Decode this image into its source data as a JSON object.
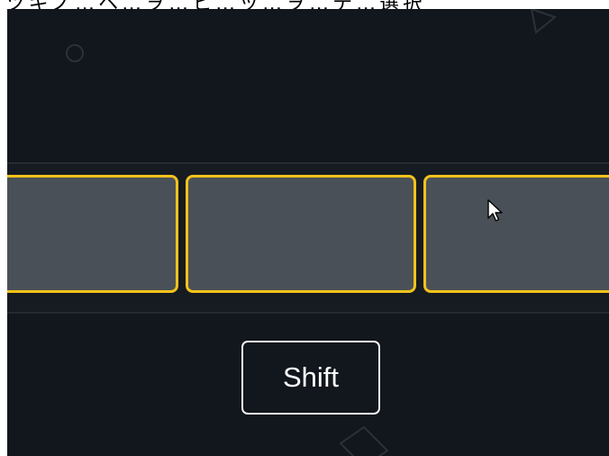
{
  "instruction_text": "ツギノ…ヘ…ヲ…ヒ…ッ…ヲ…テ…選択",
  "cards": [
    {
      "label": ""
    },
    {
      "label": ""
    },
    {
      "label": ""
    }
  ],
  "shift_button": {
    "label": "Shift"
  },
  "colors": {
    "background": "#12161d",
    "tray": "#161b21",
    "card_fill": "#4a5057",
    "card_border": "#f2c21b",
    "button_border": "#f2f2f2",
    "button_text": "#ffffff"
  },
  "icons": {
    "cursor": "mouse-pointer-icon",
    "deco_circle": "circle-outline-icon",
    "deco_triangle": "triangle-outline-icon",
    "deco_diamond": "diamond-outline-icon"
  }
}
